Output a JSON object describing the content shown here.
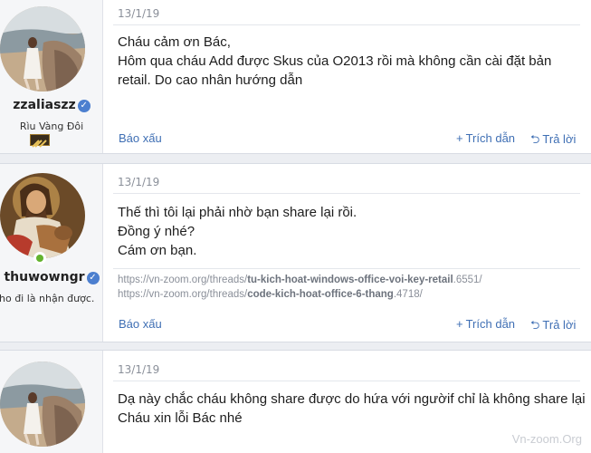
{
  "posts": [
    {
      "date": "13/1/19",
      "username": "zzaliaszz",
      "user_title": "Rìu Vàng Đôi",
      "body": [
        "Cháu cảm ơn Bác,",
        "Hôm qua cháu Add được Skus của O2013 rồi mà không cần cài đặt bản",
        "retail. Do cao nhân hướng dẫn"
      ],
      "report_label": "Báo xấu",
      "quote_label": "Trích dẫn",
      "reply_label": "Trả lời"
    },
    {
      "date": "13/1/19",
      "username": "thuwowngr",
      "user_title": "ho đi là nhận được.",
      "body": [
        "Thế thì tôi lại phải nhờ bạn share lại rồi.",
        "Đồng ý nhé?",
        "Cám ơn bạn."
      ],
      "links": [
        {
          "prefix": "https://vn-zoom.org/threads/",
          "slug": "tu-kich-hoat-windows-office-voi-key-retail",
          "suffix": ".6551/"
        },
        {
          "prefix": "https://vn-zoom.org/threads/",
          "slug": "code-kich-hoat-office-6-thang",
          "suffix": ".4718/"
        }
      ],
      "report_label": "Báo xấu",
      "quote_label": "Trích dẫn",
      "reply_label": "Trả lời"
    },
    {
      "date": "13/1/19",
      "body": [
        "Dạ này chắc cháu không share được do hứa với ngườif chỉ là không share lại",
        "Cháu xin lỗi Bác nhé"
      ]
    }
  ],
  "watermark": "Vn-zoom.Org",
  "colors": {
    "link": "#3f6fb4",
    "verified": "#4c7fcf",
    "online": "#63b32e"
  }
}
